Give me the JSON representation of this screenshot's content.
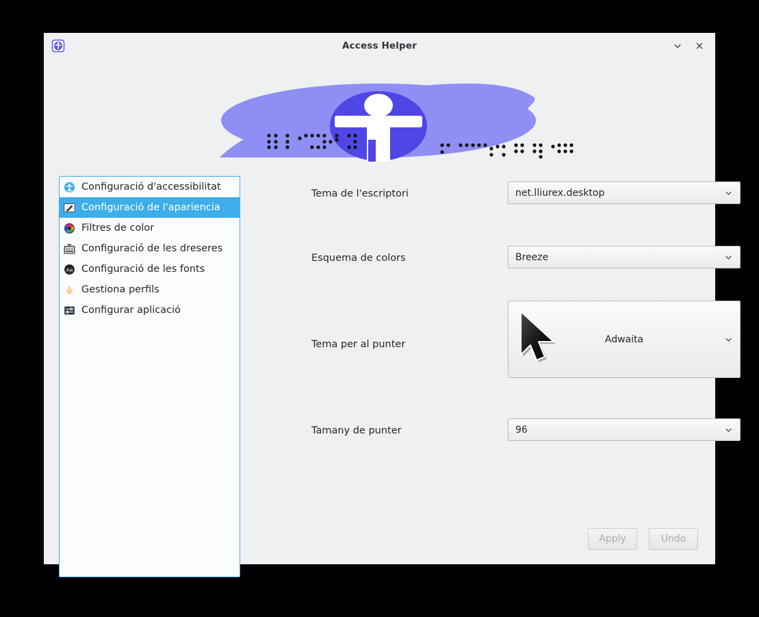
{
  "window": {
    "title": "Access Helper",
    "app_icon": "accessibility-person-icon",
    "controls": [
      {
        "name": "minimize-button",
        "icon": "chevron-down-icon",
        "glyph": "⌄"
      },
      {
        "name": "close-button",
        "icon": "close-icon",
        "glyph": "✕"
      }
    ]
  },
  "banner": {
    "name": "accessibility-banner",
    "lens_color_outer": "#8e8ef5",
    "lens_color_inner": "#4f46e5",
    "figure_color": "#ffffff",
    "background": "#eff0f1",
    "braille_dot_color": "#111111"
  },
  "sidebar": {
    "items": [
      {
        "label": "Configuració d'accessibilitat",
        "icon": "accessibility-icon",
        "selected": false
      },
      {
        "label": "Configuració de l'apariencia",
        "icon": "appearance-pencil-icon",
        "selected": true
      },
      {
        "label": "Filtres de color",
        "icon": "color-wheel-icon",
        "selected": false
      },
      {
        "label": "Configuració de les dreseres",
        "icon": "keyboard-icon",
        "selected": false
      },
      {
        "label": "Configuració de les fonts",
        "icon": "font-aa-icon",
        "selected": false
      },
      {
        "label": "Gestiona perfils",
        "icon": "droplet-icon",
        "selected": false
      },
      {
        "label": "Configurar aplicació",
        "icon": "sliders-icon",
        "selected": false
      }
    ],
    "selected_bg": "#3daee9",
    "border_color": "#3daee9"
  },
  "form": {
    "fields": [
      {
        "label": "Tema de l'escriptori",
        "value": "net.lliurex.desktop",
        "name": "desktop-theme",
        "tall": false
      },
      {
        "label": "Esquema de colors",
        "value": "Breeze",
        "name": "color-scheme",
        "tall": false
      },
      {
        "label": "Tema per al punter",
        "value": "Adwaita",
        "name": "cursor-theme",
        "tall": true
      },
      {
        "label": "Tamany de punter",
        "value": "96",
        "name": "cursor-size",
        "tall": false
      }
    ]
  },
  "actions": {
    "apply_label": "Apply",
    "undo_label": "Undo",
    "disabled_text_color": "#a9acae"
  }
}
